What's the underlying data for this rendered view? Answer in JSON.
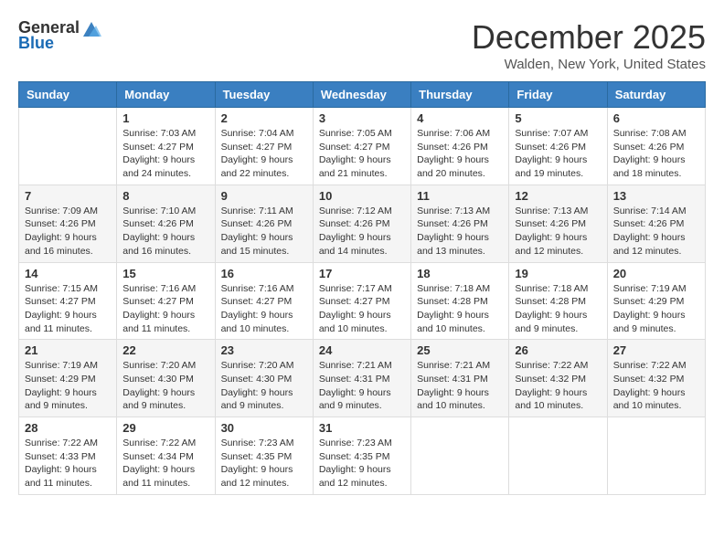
{
  "header": {
    "logo_general": "General",
    "logo_blue": "Blue",
    "month_title": "December 2025",
    "location": "Walden, New York, United States"
  },
  "days_of_week": [
    "Sunday",
    "Monday",
    "Tuesday",
    "Wednesday",
    "Thursday",
    "Friday",
    "Saturday"
  ],
  "weeks": [
    [
      {
        "day": "",
        "sunrise": "",
        "sunset": "",
        "daylight": ""
      },
      {
        "day": "1",
        "sunrise": "Sunrise: 7:03 AM",
        "sunset": "Sunset: 4:27 PM",
        "daylight": "Daylight: 9 hours and 24 minutes."
      },
      {
        "day": "2",
        "sunrise": "Sunrise: 7:04 AM",
        "sunset": "Sunset: 4:27 PM",
        "daylight": "Daylight: 9 hours and 22 minutes."
      },
      {
        "day": "3",
        "sunrise": "Sunrise: 7:05 AM",
        "sunset": "Sunset: 4:27 PM",
        "daylight": "Daylight: 9 hours and 21 minutes."
      },
      {
        "day": "4",
        "sunrise": "Sunrise: 7:06 AM",
        "sunset": "Sunset: 4:26 PM",
        "daylight": "Daylight: 9 hours and 20 minutes."
      },
      {
        "day": "5",
        "sunrise": "Sunrise: 7:07 AM",
        "sunset": "Sunset: 4:26 PM",
        "daylight": "Daylight: 9 hours and 19 minutes."
      },
      {
        "day": "6",
        "sunrise": "Sunrise: 7:08 AM",
        "sunset": "Sunset: 4:26 PM",
        "daylight": "Daylight: 9 hours and 18 minutes."
      }
    ],
    [
      {
        "day": "7",
        "sunrise": "Sunrise: 7:09 AM",
        "sunset": "Sunset: 4:26 PM",
        "daylight": "Daylight: 9 hours and 16 minutes."
      },
      {
        "day": "8",
        "sunrise": "Sunrise: 7:10 AM",
        "sunset": "Sunset: 4:26 PM",
        "daylight": "Daylight: 9 hours and 16 minutes."
      },
      {
        "day": "9",
        "sunrise": "Sunrise: 7:11 AM",
        "sunset": "Sunset: 4:26 PM",
        "daylight": "Daylight: 9 hours and 15 minutes."
      },
      {
        "day": "10",
        "sunrise": "Sunrise: 7:12 AM",
        "sunset": "Sunset: 4:26 PM",
        "daylight": "Daylight: 9 hours and 14 minutes."
      },
      {
        "day": "11",
        "sunrise": "Sunrise: 7:13 AM",
        "sunset": "Sunset: 4:26 PM",
        "daylight": "Daylight: 9 hours and 13 minutes."
      },
      {
        "day": "12",
        "sunrise": "Sunrise: 7:13 AM",
        "sunset": "Sunset: 4:26 PM",
        "daylight": "Daylight: 9 hours and 12 minutes."
      },
      {
        "day": "13",
        "sunrise": "Sunrise: 7:14 AM",
        "sunset": "Sunset: 4:26 PM",
        "daylight": "Daylight: 9 hours and 12 minutes."
      }
    ],
    [
      {
        "day": "14",
        "sunrise": "Sunrise: 7:15 AM",
        "sunset": "Sunset: 4:27 PM",
        "daylight": "Daylight: 9 hours and 11 minutes."
      },
      {
        "day": "15",
        "sunrise": "Sunrise: 7:16 AM",
        "sunset": "Sunset: 4:27 PM",
        "daylight": "Daylight: 9 hours and 11 minutes."
      },
      {
        "day": "16",
        "sunrise": "Sunrise: 7:16 AM",
        "sunset": "Sunset: 4:27 PM",
        "daylight": "Daylight: 9 hours and 10 minutes."
      },
      {
        "day": "17",
        "sunrise": "Sunrise: 7:17 AM",
        "sunset": "Sunset: 4:27 PM",
        "daylight": "Daylight: 9 hours and 10 minutes."
      },
      {
        "day": "18",
        "sunrise": "Sunrise: 7:18 AM",
        "sunset": "Sunset: 4:28 PM",
        "daylight": "Daylight: 9 hours and 10 minutes."
      },
      {
        "day": "19",
        "sunrise": "Sunrise: 7:18 AM",
        "sunset": "Sunset: 4:28 PM",
        "daylight": "Daylight: 9 hours and 9 minutes."
      },
      {
        "day": "20",
        "sunrise": "Sunrise: 7:19 AM",
        "sunset": "Sunset: 4:29 PM",
        "daylight": "Daylight: 9 hours and 9 minutes."
      }
    ],
    [
      {
        "day": "21",
        "sunrise": "Sunrise: 7:19 AM",
        "sunset": "Sunset: 4:29 PM",
        "daylight": "Daylight: 9 hours and 9 minutes."
      },
      {
        "day": "22",
        "sunrise": "Sunrise: 7:20 AM",
        "sunset": "Sunset: 4:30 PM",
        "daylight": "Daylight: 9 hours and 9 minutes."
      },
      {
        "day": "23",
        "sunrise": "Sunrise: 7:20 AM",
        "sunset": "Sunset: 4:30 PM",
        "daylight": "Daylight: 9 hours and 9 minutes."
      },
      {
        "day": "24",
        "sunrise": "Sunrise: 7:21 AM",
        "sunset": "Sunset: 4:31 PM",
        "daylight": "Daylight: 9 hours and 9 minutes."
      },
      {
        "day": "25",
        "sunrise": "Sunrise: 7:21 AM",
        "sunset": "Sunset: 4:31 PM",
        "daylight": "Daylight: 9 hours and 10 minutes."
      },
      {
        "day": "26",
        "sunrise": "Sunrise: 7:22 AM",
        "sunset": "Sunset: 4:32 PM",
        "daylight": "Daylight: 9 hours and 10 minutes."
      },
      {
        "day": "27",
        "sunrise": "Sunrise: 7:22 AM",
        "sunset": "Sunset: 4:32 PM",
        "daylight": "Daylight: 9 hours and 10 minutes."
      }
    ],
    [
      {
        "day": "28",
        "sunrise": "Sunrise: 7:22 AM",
        "sunset": "Sunset: 4:33 PM",
        "daylight": "Daylight: 9 hours and 11 minutes."
      },
      {
        "day": "29",
        "sunrise": "Sunrise: 7:22 AM",
        "sunset": "Sunset: 4:34 PM",
        "daylight": "Daylight: 9 hours and 11 minutes."
      },
      {
        "day": "30",
        "sunrise": "Sunrise: 7:23 AM",
        "sunset": "Sunset: 4:35 PM",
        "daylight": "Daylight: 9 hours and 12 minutes."
      },
      {
        "day": "31",
        "sunrise": "Sunrise: 7:23 AM",
        "sunset": "Sunset: 4:35 PM",
        "daylight": "Daylight: 9 hours and 12 minutes."
      },
      {
        "day": "",
        "sunrise": "",
        "sunset": "",
        "daylight": ""
      },
      {
        "day": "",
        "sunrise": "",
        "sunset": "",
        "daylight": ""
      },
      {
        "day": "",
        "sunrise": "",
        "sunset": "",
        "daylight": ""
      }
    ]
  ]
}
